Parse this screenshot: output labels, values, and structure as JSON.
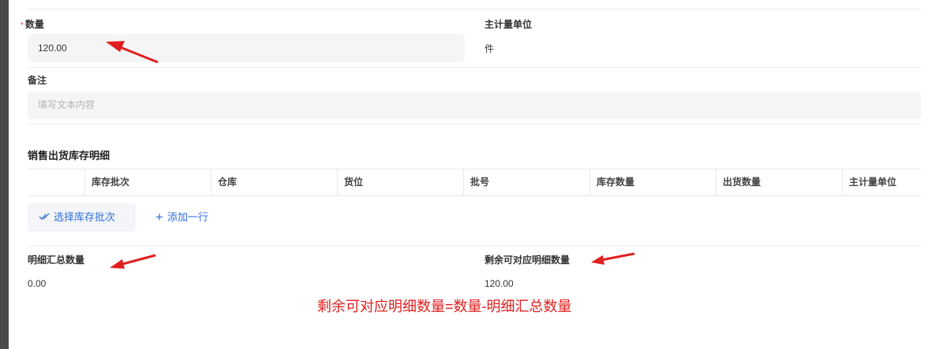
{
  "form": {
    "quantity": {
      "required_mark": "*",
      "label": "数量",
      "value": "120.00"
    },
    "unit": {
      "label": "主计量单位",
      "value": "件"
    },
    "remark": {
      "label": "备注",
      "placeholder": "填写文本内容"
    }
  },
  "detail_section": {
    "title": "销售出货库存明细",
    "columns": [
      "",
      "库存批次",
      "仓库",
      "货位",
      "批号",
      "库存数量",
      "出货数量",
      "主计量单位"
    ],
    "select_button_label": "选择库存批次",
    "add_row_label": "添加一行"
  },
  "summary": {
    "detail_total": {
      "label": "明细汇总数量",
      "value": "0.00"
    },
    "remaining": {
      "label": "剩余可对应明细数量",
      "value": "120.00"
    }
  },
  "annotation": {
    "formula": "剩余可对应明细数量=数量-明细汇总数量",
    "color": "#e02020"
  },
  "colors": {
    "accent": "#2f6fdc",
    "required": "#f04040"
  }
}
